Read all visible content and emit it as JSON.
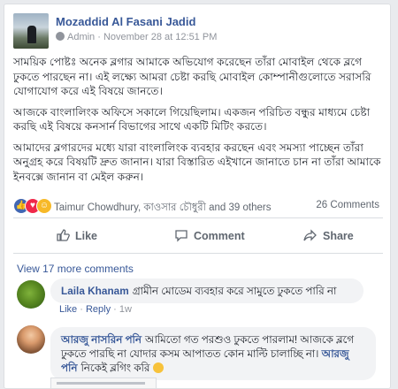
{
  "post": {
    "author": "Mozaddid Al Fasani Jadid",
    "meta": "Admin · November 28 at 12:51 PM",
    "paragraphs": [
      "সাময়িক পোষ্টঃ অনেক ব্লগার আমাকে অভিযোগ করেছেন তাঁরা মোবাইল থেকে ব্লগে ঢুকতে পারছেন না। এই লক্ষ্যে আমরা চেষ্টা করছি মোবাইল কোম্পানীগুলোতে সরাসরি যোগাযোগ করে এই বিষয়ে জানতে।",
      "আজকে বাংলালিংক অফিসে সকালে গিয়েছিলাম। একজন পরিচিত বন্ধুর মাধ্যমে চেষ্টা করছি এই বিষয়ে কনসার্ন বিভাগের সাথে একটি মিটিং করতে।",
      "আমাদের ব্লগারদের মধ্যে যারা বাংলালিংক ব্যবহার করছেন এবং সমস্যা পাচ্ছেন তাঁরা অনুগ্রহ করে বিষয়টি দ্রুত জানান। যারা বিস্তারিত এইখানে জানাতে চান না তাঁরা আমাকে ইনবক্সে জানান বা মেইল করুন।"
    ]
  },
  "reactions": {
    "names": "Taimur Chowdhury, কাওসার চৌধুরী and 39 others",
    "comments_count": "26 Comments",
    "icons": [
      "like-icon",
      "love-icon",
      "wow-icon"
    ]
  },
  "actions": {
    "like": "Like",
    "comment": "Comment",
    "share": "Share"
  },
  "view_more": "View 17 more comments",
  "comments": [
    {
      "name": "Laila Khanam",
      "text": "গ্রামীন মোডেম ব্যবহার করে সামুতে ঢুকতে পারি না",
      "like": "Like",
      "reply": "Reply",
      "time": "1w"
    },
    {
      "name": "আরজু নাসরিন পনি",
      "text": "আমিতো গত পরশুও ঢুকতে পারলাম! আজকে ব্লগে ঢুকতে পারছি না যোদার কসম আপাতত কোন মাল্টি চালাচ্ছি না।",
      "mention": "আরজু পনি",
      "text_after": "নিকেই ব্লগিং করি"
    }
  ],
  "colors": {
    "link": "#385898",
    "muted": "#90949c",
    "bubble": "#f2f3f5"
  }
}
